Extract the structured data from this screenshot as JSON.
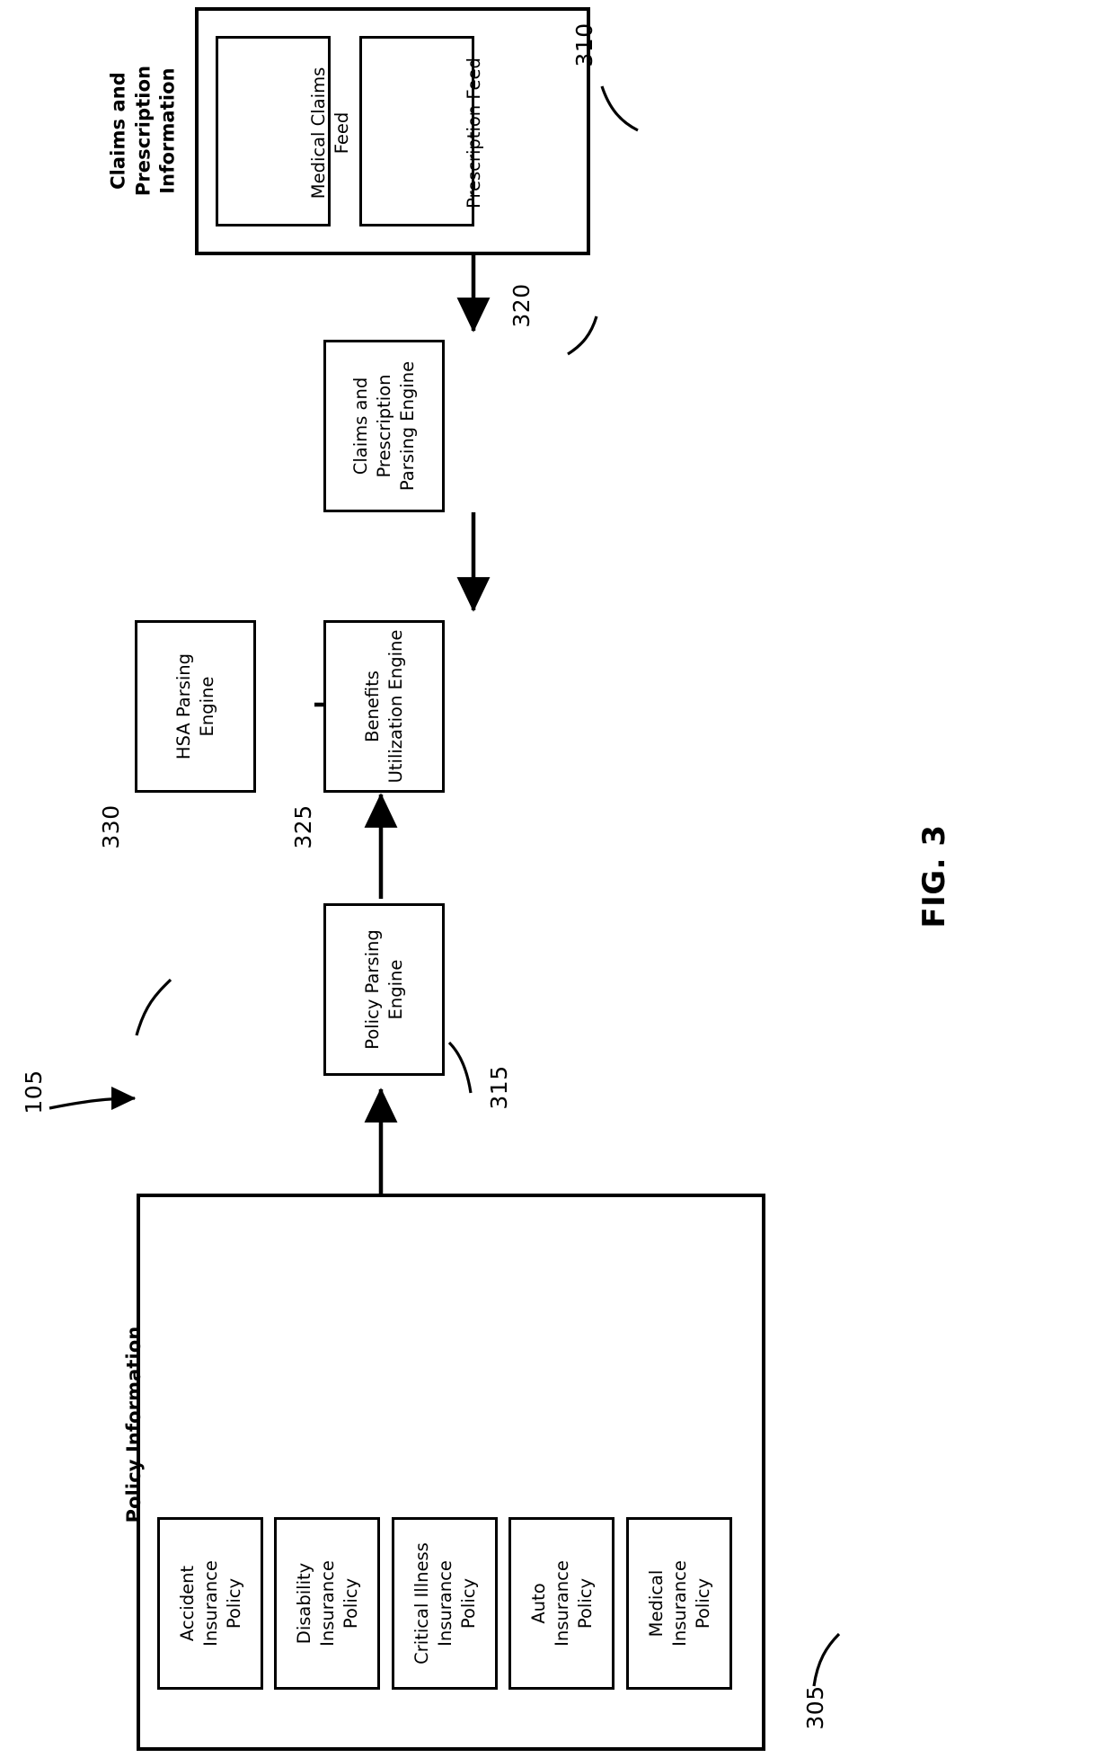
{
  "figure": {
    "label": "FIG. 3",
    "system_ref": "105"
  },
  "groups": [
    {
      "id": "claims-prescription-information",
      "title": "Claims and\nPrescription\nInformation",
      "ref": "310",
      "items": [
        {
          "id": "medical-claims-feed",
          "label": "Medical Claims\nFeed"
        },
        {
          "id": "prescription-feed",
          "label": "Prescription Feed"
        }
      ]
    },
    {
      "id": "policy-information",
      "title": "Policy Information",
      "ref": "305",
      "items": [
        {
          "id": "accident-insurance-policy",
          "label": "Accident\nInsurance\nPolicy"
        },
        {
          "id": "disability-insurance-policy",
          "label": "Disability\nInsurance\nPolicy"
        },
        {
          "id": "critical-illness-insurance-policy",
          "label": "Critical Illness\nInsurance\nPolicy"
        },
        {
          "id": "auto-insurance-policy",
          "label": "Auto\nInsurance\nPolicy"
        },
        {
          "id": "medical-insurance-policy",
          "label": "Medical\nInsurance\nPolicy"
        }
      ]
    }
  ],
  "engines": [
    {
      "id": "claims-prescription-parsing-engine",
      "label": "Claims and\nPrescription\nParsing Engine",
      "ref": "320"
    },
    {
      "id": "hsa-parsing-engine",
      "label": "HSA Parsing\nEngine",
      "ref": "330"
    },
    {
      "id": "benefits-utilization-engine",
      "label": "Benefits\nUtilization Engine",
      "ref": "325"
    },
    {
      "id": "policy-parsing-engine",
      "label": "Policy Parsing\nEngine",
      "ref": "315"
    }
  ],
  "flows": [
    {
      "id": "flow-claims-to-parsing",
      "from": "claims-prescription-information",
      "to": "claims-prescription-parsing-engine"
    },
    {
      "id": "flow-parsing-to-benefits",
      "from": "claims-prescription-parsing-engine",
      "to": "benefits-utilization-engine"
    },
    {
      "id": "flow-hsa-to-benefits",
      "from": "hsa-parsing-engine",
      "to": "benefits-utilization-engine"
    },
    {
      "id": "flow-policyparsing-to-benefits",
      "from": "policy-parsing-engine",
      "to": "benefits-utilization-engine"
    },
    {
      "id": "flow-policyinfo-to-policyparsing",
      "from": "policy-information",
      "to": "policy-parsing-engine"
    }
  ],
  "colors": {
    "stroke": "#000000",
    "background": "#ffffff",
    "text": "#000000"
  }
}
